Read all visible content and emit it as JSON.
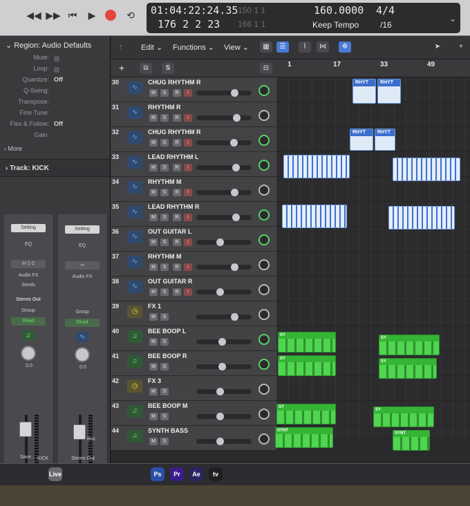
{
  "transport": {
    "time": "01:04:22:24.35",
    "bars": "176  2  2    23",
    "dim_top": "150   1   1",
    "dim_bottom": "166   1   1",
    "tempo": "160.0000",
    "tempo_mode": "Keep Tempo",
    "signature": "4/4",
    "division": "/16",
    "buttons": [
      "rewind",
      "fast-forward",
      "go-to-start",
      "play",
      "record",
      "cycle"
    ]
  },
  "inspector": {
    "region_title": "Region: Audio Defaults",
    "params": [
      {
        "label": "Mute:",
        "value": ""
      },
      {
        "label": "Loop:",
        "value": ""
      },
      {
        "label": "Quantize:",
        "value": "Off"
      },
      {
        "label": "Q-Swing:",
        "value": ""
      },
      {
        "label": "Transpose:",
        "value": ""
      },
      {
        "label": "Fine Tune:",
        "value": ""
      },
      {
        "label": "Flex & Follow:",
        "value": "Off"
      },
      {
        "label": "Gain:",
        "value": ""
      }
    ],
    "more": "More",
    "track_title": "Track: KICK",
    "strip_left": {
      "setting": "Setting",
      "eq": "EQ",
      "input": "In 1-2",
      "fx": "Audio FX",
      "sends": "Sends",
      "output": "Stereo Out",
      "group": "Group",
      "automation": "Read",
      "volume": "0.0",
      "name": "KICK",
      "save": "Save..."
    },
    "strip_right": {
      "setting": "Setting",
      "eq": "EQ",
      "fx": "Audio FX",
      "group": "Group",
      "automation": "Read",
      "volume": "0.0",
      "bnc": "Bnc",
      "name": "Stereo Out"
    }
  },
  "toolbar": {
    "edit": "Edit",
    "functions": "Functions",
    "view": "View",
    "add_label": "+",
    "s_label": "S"
  },
  "ruler": [
    "1",
    "17",
    "33",
    "49"
  ],
  "tracks": [
    {
      "num": "30",
      "name": "CHUG RHYTHM R",
      "type": "audio",
      "vol": 0.72,
      "pan_green": true
    },
    {
      "num": "31",
      "name": "RHYTHM R",
      "type": "audio",
      "vol": 0.75,
      "pan_green": false
    },
    {
      "num": "32",
      "name": "CHUG RHYTHM R",
      "type": "audio",
      "vol": 0.7,
      "pan_green": true
    },
    {
      "num": "33",
      "name": "LEAD RHYTHM L",
      "type": "audio",
      "vol": 0.74,
      "pan_green": true
    },
    {
      "num": "34",
      "name": "RHYTHM M",
      "type": "audio",
      "vol": 0.72,
      "pan_green": false
    },
    {
      "num": "35",
      "name": "LEAD RHYTHM R",
      "type": "audio",
      "vol": 0.74,
      "pan_green": true
    },
    {
      "num": "36",
      "name": "OUT GUITAR L",
      "type": "audio",
      "vol": 0.42,
      "pan_green": true
    },
    {
      "num": "37",
      "name": "RHYTHM M",
      "type": "audio",
      "vol": 0.72,
      "pan_green": false
    },
    {
      "num": "38",
      "name": "OUT GUITAR R",
      "type": "audio",
      "vol": 0.42,
      "pan_green": false
    },
    {
      "num": "39",
      "name": "FX 1",
      "type": "aux",
      "vol": 0.72,
      "pan_green": false
    },
    {
      "num": "40",
      "name": "BEE BOOP L",
      "type": "midi",
      "vol": 0.45,
      "pan_green": true
    },
    {
      "num": "41",
      "name": "BEE BOOP R",
      "type": "midi",
      "vol": 0.45,
      "pan_green": true
    },
    {
      "num": "42",
      "name": "FX 3",
      "type": "aux",
      "vol": 0.42,
      "pan_green": false
    },
    {
      "num": "43",
      "name": "BEE BOOP M",
      "type": "midi",
      "vol": 0.42,
      "pan_green": false
    },
    {
      "num": "44",
      "name": "SYNTH BASS",
      "type": "midi",
      "vol": 0.42,
      "pan_green": false
    }
  ],
  "track_buttons": {
    "mute": "M",
    "solo": "S",
    "record": "R",
    "input": "I"
  },
  "region_labels": {
    "rhythm": "RHYT",
    "synth": "SY",
    "synth_bass": "SYNT"
  },
  "dock": [
    "Live",
    "Ps",
    "Pr",
    "Ae",
    "tv"
  ],
  "colors": {
    "audio": "#3b6fcf",
    "midi": "#34b534",
    "aux": "#f0d84a",
    "record": "#e3453c"
  }
}
